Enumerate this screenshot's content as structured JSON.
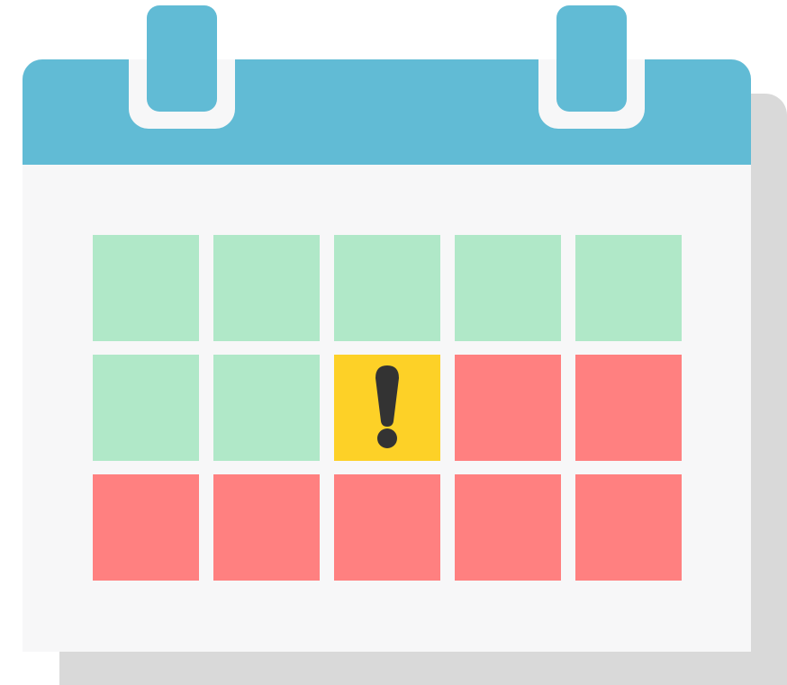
{
  "calendar": {
    "colors": {
      "header": "#61bbd5",
      "page": "#f7f7f8",
      "shadow": "#d9d9d9",
      "ok": "#b0e8c8",
      "warning": "#fdd127",
      "bad": "#ff8080",
      "glyph": "#333333"
    },
    "binding_rings": [
      "ring-left",
      "ring-right"
    ],
    "days": [
      {
        "status": "ok"
      },
      {
        "status": "ok"
      },
      {
        "status": "ok"
      },
      {
        "status": "ok"
      },
      {
        "status": "ok"
      },
      {
        "status": "ok"
      },
      {
        "status": "ok"
      },
      {
        "status": "warning",
        "icon": "exclamation-icon"
      },
      {
        "status": "bad"
      },
      {
        "status": "bad"
      },
      {
        "status": "bad"
      },
      {
        "status": "bad"
      },
      {
        "status": "bad"
      },
      {
        "status": "bad"
      },
      {
        "status": "bad"
      }
    ]
  }
}
